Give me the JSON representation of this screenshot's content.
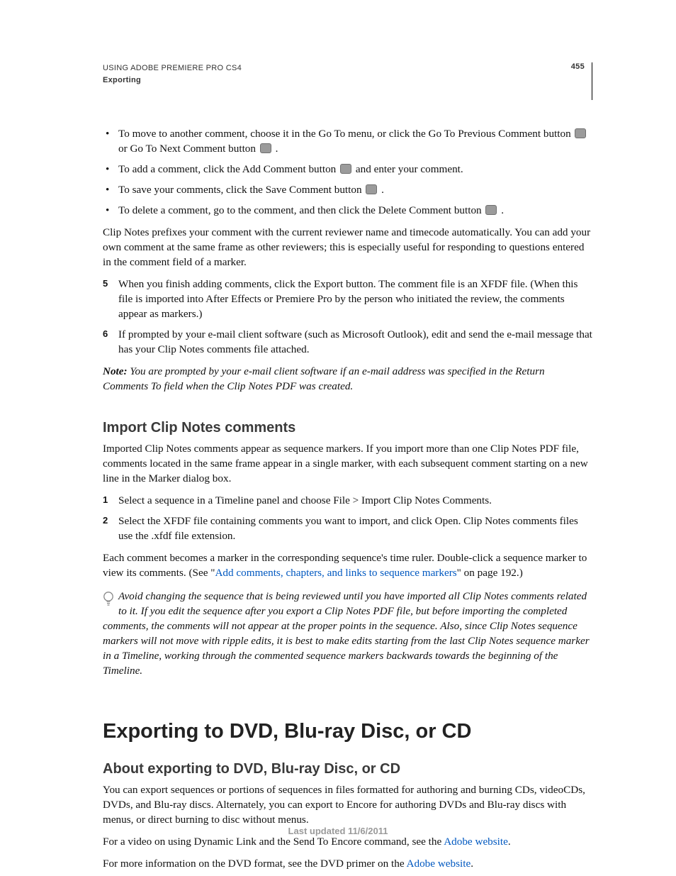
{
  "header": {
    "title_line1": "USING ADOBE PREMIERE PRO CS4",
    "title_line2": "Exporting",
    "page_number": "455"
  },
  "bullets_top": [
    {
      "pre": "To move to another comment, choose it in the Go To menu, or click the Go To Previous Comment button ",
      "icon1_name": "previous-comment-icon",
      "mid": " or Go To Next Comment button ",
      "icon2_name": "next-comment-icon",
      "post": "."
    },
    {
      "pre": "To add a comment, click the Add Comment button ",
      "icon1_name": "add-comment-icon",
      "post": " and enter your comment."
    },
    {
      "pre": "To save your comments, click the Save Comment button ",
      "icon1_name": "save-comment-icon",
      "post": "."
    },
    {
      "pre": "To delete a comment, go to the comment, and then click the Delete Comment button ",
      "icon1_name": "delete-comment-icon",
      "post": "."
    }
  ],
  "para_prefix": "Clip Notes prefixes your comment with the current reviewer name and timecode automatically. You can add your own comment at the same frame as other reviewers; this is especially useful for responding to questions entered in the comment field of a marker.",
  "steps_5_6": [
    {
      "num": "5",
      "text": "When you finish adding comments, click the Export button. The comment file is an XFDF file. (When this file is imported into After Effects or Premiere Pro by the person who initiated the review, the comments appear as markers.)"
    },
    {
      "num": "6",
      "text": "If prompted by your e-mail client software (such as Microsoft Outlook), edit and send the e-mail message that has your Clip Notes comments file attached."
    }
  ],
  "note": {
    "label": "Note:",
    "text": " You are prompted by your e-mail client software if an e-mail address was specified in the Return Comments To field when the Clip Notes PDF was created."
  },
  "import_section": {
    "heading": "Import Clip Notes comments",
    "intro": "Imported Clip Notes comments appear as sequence markers. If you import more than one Clip Notes PDF file, comments located in the same frame appear in a single marker, with each subsequent comment starting on a new line in the Marker dialog box.",
    "steps": [
      {
        "num": "1",
        "text": "Select a sequence in a Timeline panel and choose File > Import Clip Notes Comments."
      },
      {
        "num": "2",
        "text": "Select the XFDF file containing comments you want to import, and click Open. Clip Notes comments files use the .xfdf file extension."
      }
    ],
    "para_after_pre": "Each comment becomes a marker in the corresponding sequence's time ruler. Double-click a sequence marker to view its comments. (See \"",
    "para_after_link": "Add comments, chapters, and links to sequence markers",
    "para_after_post": "\" on page 192.)",
    "tip": "Avoid changing the sequence that is being reviewed until you have imported all Clip Notes comments related to it. If you edit the sequence after you export a Clip Notes PDF file, but before importing the completed comments, the comments will not appear at the proper points in the sequence. Also, since Clip Notes sequence markers will not move with ripple edits, it is best to make edits starting from the last Clip Notes sequence marker in a Timeline, working through the commented sequence markers backwards towards the beginning of the Timeline."
  },
  "export_section": {
    "h1": "Exporting to DVD, Blu-ray Disc, or CD",
    "h2": "About exporting to DVD, Blu-ray Disc, or CD",
    "p1": "You can export sequences or portions of sequences in files formatted for authoring and burning CDs, videoCDs, DVDs, and Blu-ray discs. Alternately, you can export to Encore for authoring DVDs and Blu-ray discs with menus, or direct burning to disc without menus.",
    "p2_pre": "For a video on using Dynamic Link and the Send To Encore command, see the ",
    "p2_link": "Adobe website",
    "p2_post": ".",
    "p3_pre": "For more information on the DVD format, see the DVD primer on the ",
    "p3_link": "Adobe website",
    "p3_post": "."
  },
  "footer": "Last updated 11/6/2011"
}
